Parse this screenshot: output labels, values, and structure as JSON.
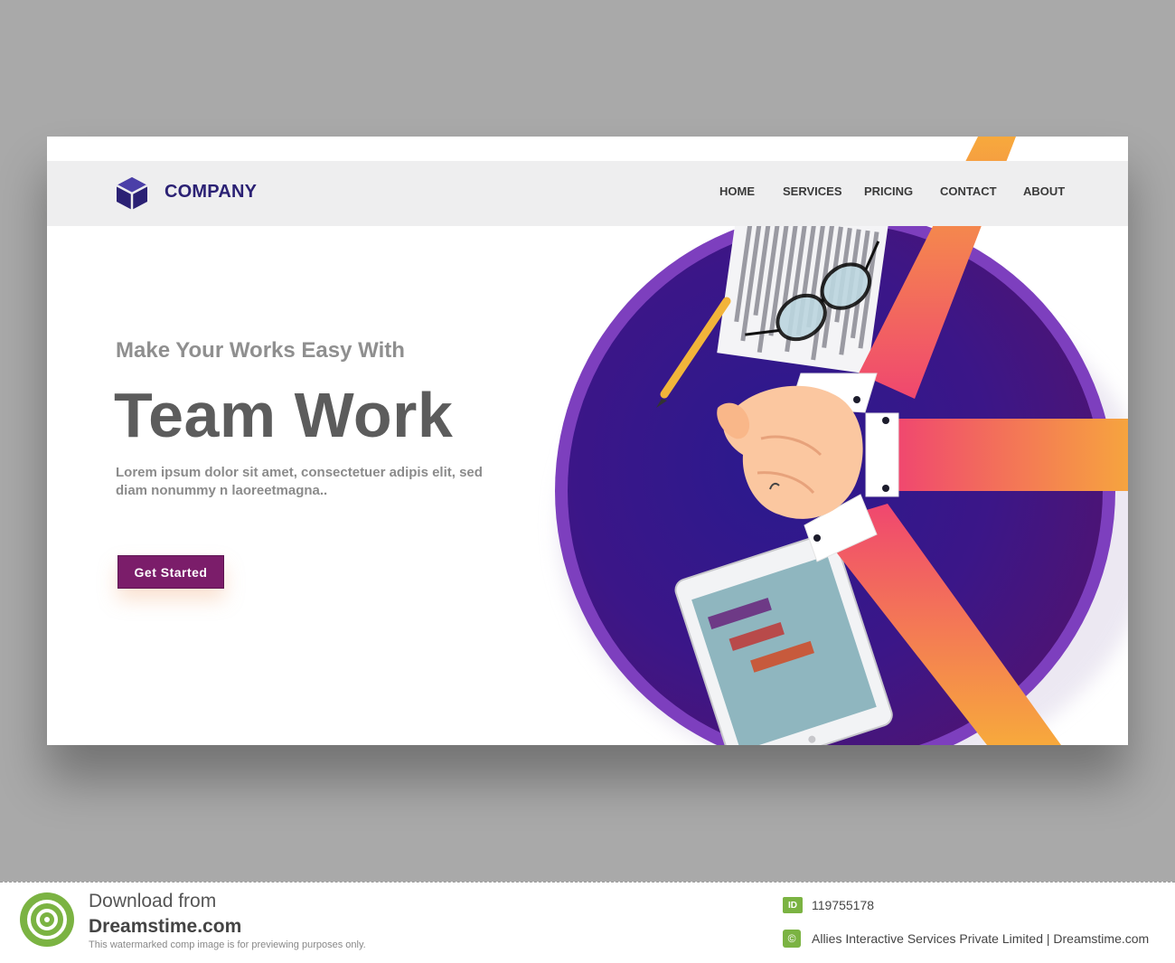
{
  "header": {
    "brand_name": "COMPANY",
    "logo_icon": "cube-icon",
    "nav": [
      {
        "label": "HOME"
      },
      {
        "label": "SERVICES"
      },
      {
        "label": "PRICING"
      },
      {
        "label": "CONTACT"
      },
      {
        "label": "ABOUT"
      }
    ]
  },
  "hero": {
    "subtitle": "Make Your Works Easy With",
    "title": "Team Work",
    "description": "Lorem ipsum dolor sit amet, consectetuer adipis elit, sed diam nonummy n laoreetmagna..",
    "cta_label": "Get Started"
  },
  "illustration": {
    "icons": [
      "team-hands-illustration",
      "round-table-icon",
      "tablet-chart-icon",
      "document-icon",
      "glasses-icon",
      "pencil-icon"
    ]
  },
  "footer": {
    "download_text": "Download from",
    "site_name": "Dreamstime.com",
    "note": "This watermarked comp image is for previewing purposes only.",
    "id_label": "ID",
    "image_id": "119755178",
    "credit": "Allies Interactive Services Private Limited | Dreamstime.com"
  },
  "colors": {
    "accent_purple": "#7b1d6a",
    "brand_navy": "#2b2174",
    "table_purple": "#3a1692",
    "arm_orange": "#f6a23d",
    "arm_pink": "#f2527c",
    "page_background": "#a9a9a9"
  }
}
